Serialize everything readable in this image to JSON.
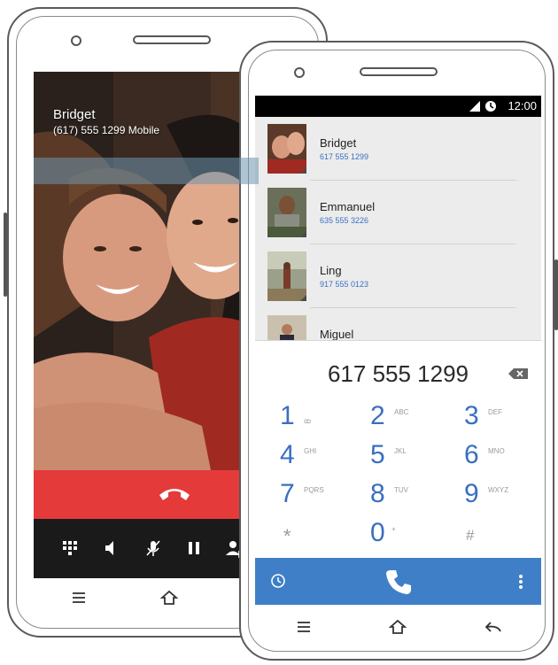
{
  "back_phone": {
    "caller_name": "Bridget",
    "caller_number": "(617) 555 1299 Mobile",
    "controls": [
      "dialpad-icon",
      "speaker-icon",
      "mute-icon",
      "pause-icon",
      "add-call-icon"
    ],
    "end_call_color": "#e53a3a"
  },
  "front_phone": {
    "status": {
      "time": "12:00",
      "icons": [
        "signal-icon",
        "alarm-icon"
      ]
    },
    "contacts": [
      {
        "name": "Bridget",
        "phone": "617 555 1299"
      },
      {
        "name": "Emmanuel",
        "phone": "635 555 3226"
      },
      {
        "name": "Ling",
        "phone": "917 555 0123"
      },
      {
        "name": "Miguel",
        "phone": ""
      }
    ],
    "dialed_number": "617 555 1299",
    "keypad": [
      {
        "digit": "1",
        "letters": "ꝏ"
      },
      {
        "digit": "2",
        "letters": "ABC"
      },
      {
        "digit": "3",
        "letters": "DEF"
      },
      {
        "digit": "4",
        "letters": "GHI"
      },
      {
        "digit": "5",
        "letters": "JKL"
      },
      {
        "digit": "6",
        "letters": "MNO"
      },
      {
        "digit": "7",
        "letters": "PQRS"
      },
      {
        "digit": "8",
        "letters": "TUV"
      },
      {
        "digit": "9",
        "letters": "WXYZ"
      },
      {
        "digit": "*",
        "letters": ""
      },
      {
        "digit": "0",
        "letters": "+"
      },
      {
        "digit": "#",
        "letters": ""
      }
    ],
    "accent_color": "#3f7fc8"
  }
}
